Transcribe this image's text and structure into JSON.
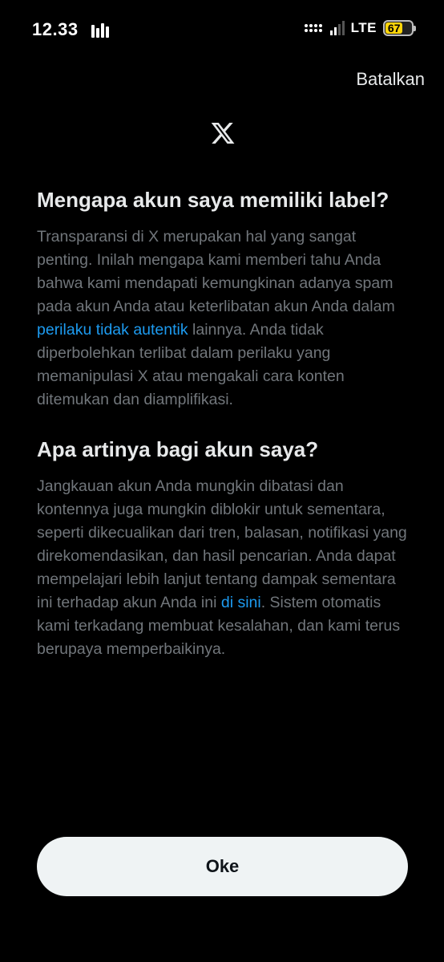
{
  "status_bar": {
    "time": "12.33",
    "network": "LTE",
    "battery": "67",
    "battery_level": 0.67
  },
  "header": {
    "cancel_label": "Batalkan",
    "logo_icon": "x-logo-icon"
  },
  "section1": {
    "heading": "Mengapa akun saya memiliki label?",
    "text_before_link": "Transparansi di X merupakan hal yang sangat penting. Inilah mengapa kami memberi tahu Anda bahwa kami mendapati kemungkinan adanya spam pada akun Anda atau keterlibatan akun Anda dalam ",
    "link": "perilaku tidak autentik",
    "text_after_link": " lainnya. Anda tidak diperbolehkan terlibat dalam perilaku yang memanipulasi X atau mengakali cara konten ditemukan dan diamplifikasi."
  },
  "section2": {
    "heading": "Apa artinya bagi akun saya?",
    "text_before_link": "Jangkauan akun Anda mungkin dibatasi dan kontennya juga mungkin diblokir untuk sementara, seperti dikecualikan dari tren, balasan, notifikasi yang direkomendasikan, dan hasil pencarian. Anda dapat mempelajari lebih lanjut tentang dampak sementara ini terhadap akun Anda ini ",
    "link": "di sini",
    "text_after_link": ". Sistem otomatis kami terkadang membuat kesalahan, dan kami terus berupaya memperbaikinya."
  },
  "footer": {
    "ok_label": "Oke"
  },
  "colors": {
    "background": "#000000",
    "heading": "#e7e9ea",
    "body_text": "#71767b",
    "link": "#1d9bf0",
    "button_bg": "#eff3f4",
    "battery": "#ffd60a"
  }
}
